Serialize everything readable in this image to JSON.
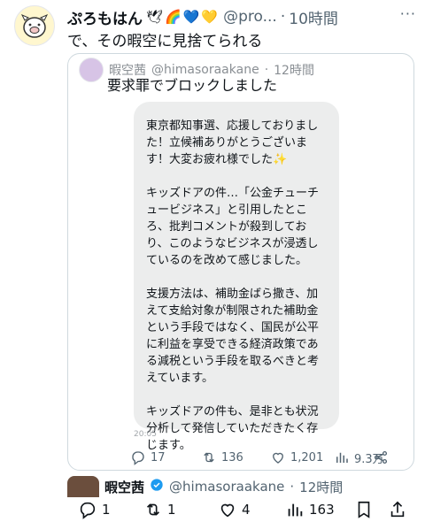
{
  "tweet": {
    "name": "ぷろもはん",
    "emojis": [
      "🕊",
      "🌈",
      "💙",
      "💛"
    ],
    "handle": "@pro...",
    "dot": "·",
    "time": "10時間",
    "more": "···",
    "text": "で、その暇空に見捨てられる"
  },
  "quote": {
    "header_name": "暇空茜",
    "header_handle": "@himasoraakane",
    "header_time": "12時間",
    "title": "要求罪でブロックしました",
    "bubble_text": "東京都知事選、応援しておりました！立候補ありがとうございます！大変お疲れ様でした✨\n\nキッズドアの件…「公金チューチュービジネス」と引用したところ、批判コメントが殺到しており、このようなビジネスが浸透しているのを改めて感じました。\n\n支援方法は、補助金ばら撒き、加えて支給対象が制限された補助金という手段ではなく、国民が公平に利益を享受できる経済政策である減税という手段を取るべきと考えています。\n\nキッズドアの件も、是非とも状況分析して発信していただきたく存じます。\n\n大変ご多用のところ、暇空茜さまのお力を頼りにしてしまい誠に恐れ入りますが、どうぞよろしくお願いいたします🙏🙇‍♀️",
    "message_time": "20:05",
    "actions": {
      "replies": "17",
      "retweets": "136",
      "likes": "1,201",
      "views": "9.3万"
    }
  },
  "next_tweet": {
    "name": "暇空茜",
    "handle": "@himasoraakane",
    "dot": "·",
    "time": "12時間"
  },
  "actions": {
    "replies": "1",
    "retweets": "1",
    "likes": "4",
    "views": "163"
  },
  "colors": {
    "text": "#0f1419",
    "muted": "#536471",
    "border": "#cfd9de",
    "bubble": "#eceded",
    "verified": "#1d9bf0"
  }
}
